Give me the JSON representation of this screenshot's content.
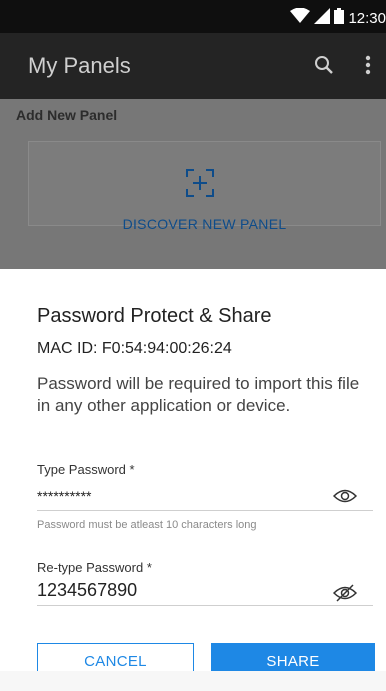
{
  "status_bar": {
    "time": "12:30",
    "icons": [
      "wifi-icon",
      "signal-icon",
      "battery-icon"
    ]
  },
  "app_bar": {
    "title": "My Panels",
    "icons": [
      "search-icon",
      "more-vert-icon"
    ]
  },
  "page": {
    "section_title": "Add New Panel",
    "discover_label": "DISCOVER NEW PANEL",
    "discover_icon": "scan-add-icon"
  },
  "dialog": {
    "title": "Password Protect & Share",
    "mac": "MAC ID: F0:54:94:00:26:24",
    "description": "Password will be required to import this file in any other application or device.",
    "password_label": "Type Password *",
    "password_value": "**********",
    "password_helper": "Password must be atleast 10 characters long",
    "retype_label": "Re-type Password *",
    "retype_value": "1234567890",
    "cancel_label": "CANCEL",
    "share_label": "SHARE"
  },
  "colors": {
    "accent": "#1e88e5",
    "status_bar": "#0f0f0f",
    "app_bar": "#242424",
    "scrim": "#777777"
  }
}
